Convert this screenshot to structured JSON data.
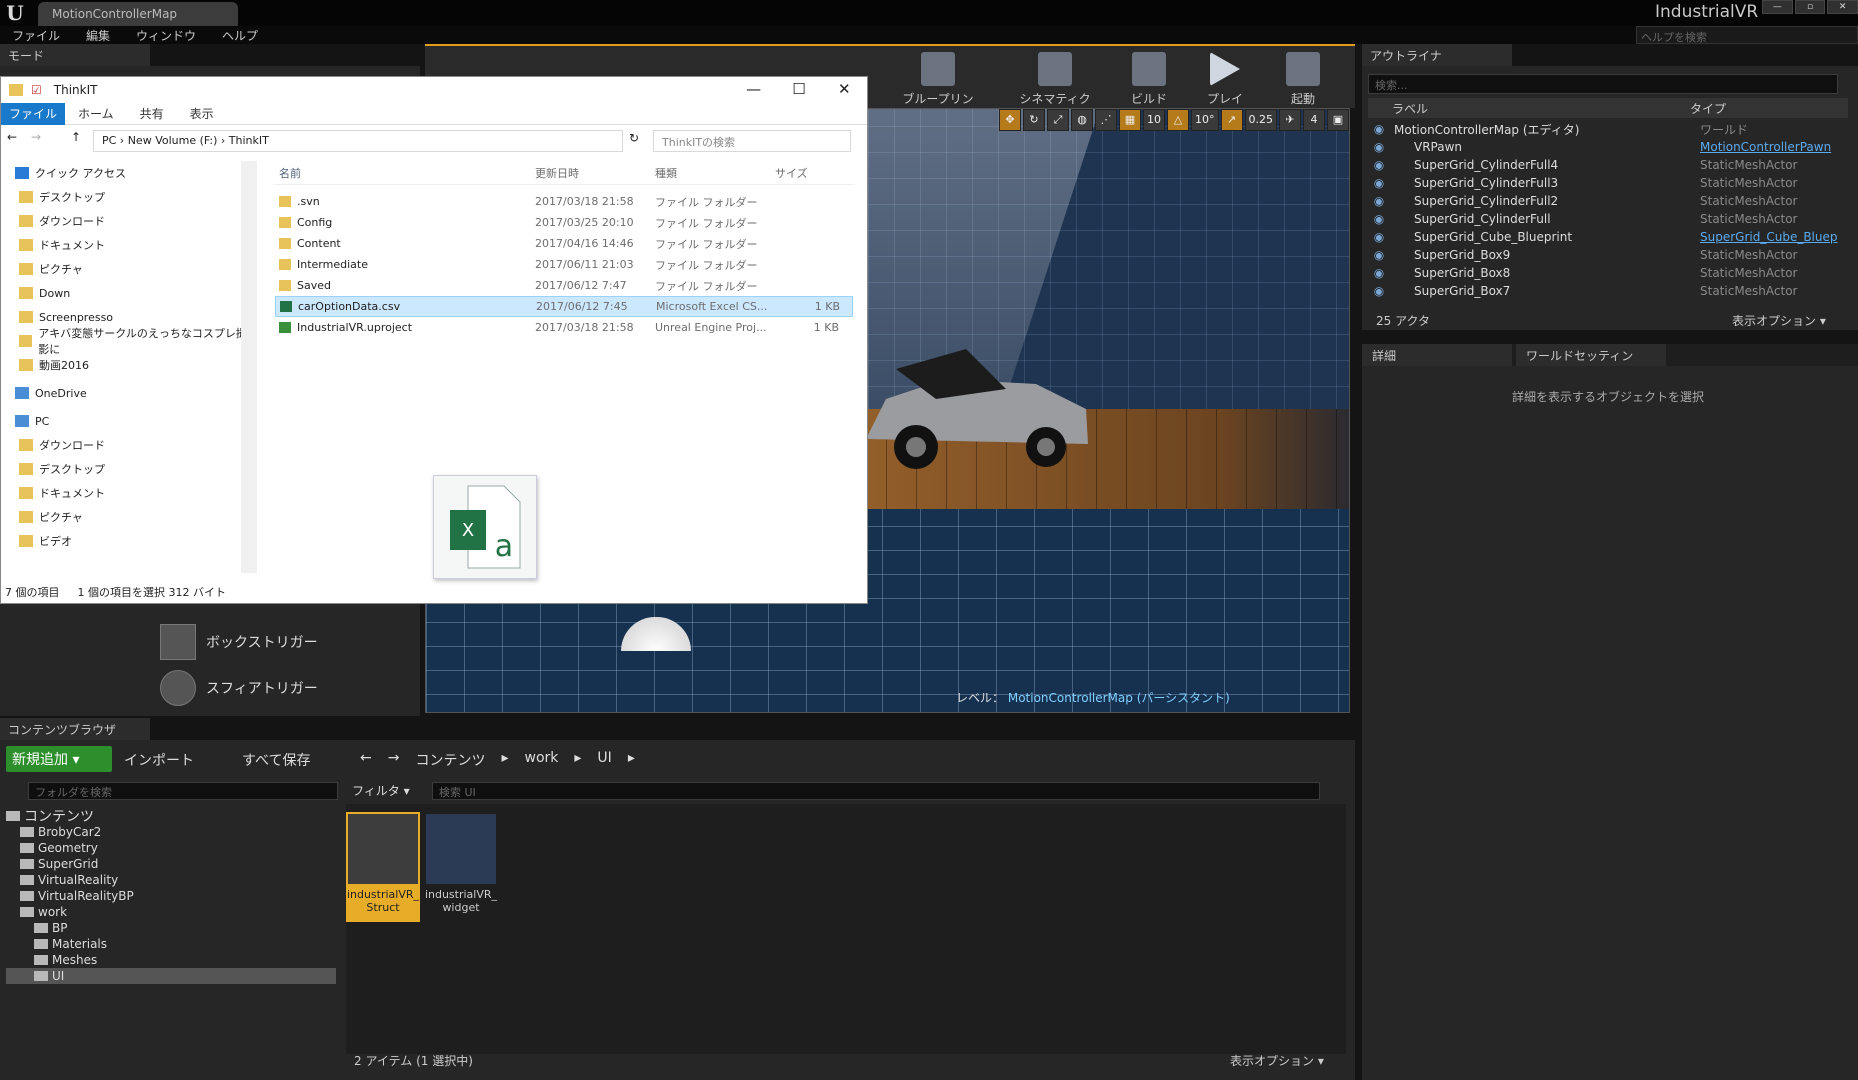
{
  "titlebar": {
    "tab": "MotionControllerMap",
    "project": "IndustrialVR",
    "help_placeholder": "ヘルプを検索"
  },
  "menu": [
    "ファイル",
    "編集",
    "ウィンドウ",
    "ヘルプ"
  ],
  "mode_tab": "モード",
  "mode_items": [
    "ボックストリガー",
    "スフィアトリガー"
  ],
  "toolbar": [
    "ブループリント",
    "シネマティクス",
    "ビルド",
    "プレイ",
    "起動"
  ],
  "viewport": {
    "toolbar": [
      "10",
      "10°",
      "0.25",
      "4"
    ],
    "level_label": "レベル：",
    "level_name": "MotionControllerMap (パーシスタント)"
  },
  "explorer": {
    "title": "ThinkIT",
    "ribbon": [
      "ファイル",
      "ホーム",
      "共有",
      "表示"
    ],
    "path": "PC  ›  New Volume (F:)  ›  ThinkIT",
    "search_placeholder": "ThinkITの検索",
    "nav": [
      {
        "label": "クイック アクセス",
        "sub": false
      },
      {
        "label": "デスクトップ",
        "sub": true
      },
      {
        "label": "ダウンロード",
        "sub": true
      },
      {
        "label": "ドキュメント",
        "sub": true
      },
      {
        "label": "ピクチャ",
        "sub": true
      },
      {
        "label": "Down",
        "sub": true
      },
      {
        "label": "Screenpresso",
        "sub": true
      },
      {
        "label": "アキバ変態サークルのえっちなコスプレ撮影に",
        "sub": true
      },
      {
        "label": "動画2016",
        "sub": true
      },
      {
        "label": "OneDrive",
        "sub": false
      },
      {
        "label": "PC",
        "sub": false
      },
      {
        "label": "ダウンロード",
        "sub": true
      },
      {
        "label": "デスクトップ",
        "sub": true
      },
      {
        "label": "ドキュメント",
        "sub": true
      },
      {
        "label": "ピクチャ",
        "sub": true
      },
      {
        "label": "ビデオ",
        "sub": true
      }
    ],
    "columns": [
      "名前",
      "更新日時",
      "種類",
      "サイズ"
    ],
    "files": [
      {
        "name": ".svn",
        "date": "2017/03/18 21:58",
        "type": "ファイル フォルダー",
        "size": "",
        "selected": false
      },
      {
        "name": "Config",
        "date": "2017/03/25 20:10",
        "type": "ファイル フォルダー",
        "size": "",
        "selected": false
      },
      {
        "name": "Content",
        "date": "2017/04/16 14:46",
        "type": "ファイル フォルダー",
        "size": "",
        "selected": false
      },
      {
        "name": "Intermediate",
        "date": "2017/06/11 21:03",
        "type": "ファイル フォルダー",
        "size": "",
        "selected": false
      },
      {
        "name": "Saved",
        "date": "2017/06/12 7:47",
        "type": "ファイル フォルダー",
        "size": "",
        "selected": false
      },
      {
        "name": "carOptionData.csv",
        "date": "2017/06/12 7:45",
        "type": "Microsoft Excel CS...",
        "size": "1 KB",
        "selected": true
      },
      {
        "name": "IndustrialVR.uproject",
        "date": "2017/03/18 21:58",
        "type": "Unreal Engine Proj...",
        "size": "1 KB",
        "selected": false
      }
    ],
    "status": [
      "7 個の項目",
      "1 個の項目を選択  312 バイト"
    ]
  },
  "outliner": {
    "tab": "アウトライナ",
    "search_placeholder": "検索...",
    "columns": [
      "ラベル",
      "タイプ"
    ],
    "rows": [
      {
        "label": "MotionControllerMap (エディタ)",
        "type": "ワールド",
        "link": false
      },
      {
        "label": "VRPawn",
        "type": "MotionControllerPawn",
        "link": true
      },
      {
        "label": "SuperGrid_CylinderFull4",
        "type": "StaticMeshActor",
        "link": false
      },
      {
        "label": "SuperGrid_CylinderFull3",
        "type": "StaticMeshActor",
        "link": false
      },
      {
        "label": "SuperGrid_CylinderFull2",
        "type": "StaticMeshActor",
        "link": false
      },
      {
        "label": "SuperGrid_CylinderFull",
        "type": "StaticMeshActor",
        "link": false
      },
      {
        "label": "SuperGrid_Cube_Blueprint",
        "type": "SuperGrid_Cube_Bluep",
        "link": true
      },
      {
        "label": "SuperGrid_Box9",
        "type": "StaticMeshActor",
        "link": false
      },
      {
        "label": "SuperGrid_Box8",
        "type": "StaticMeshActor",
        "link": false
      },
      {
        "label": "SuperGrid_Box7",
        "type": "StaticMeshActor",
        "link": false
      }
    ],
    "count": "25 アクタ",
    "view_options": "表示オプション ▾"
  },
  "details": {
    "tabs": [
      "詳細",
      "ワールドセッティン"
    ],
    "message": "詳細を表示するオブジェクトを選択"
  },
  "content_browser": {
    "tab": "コンテンツブラウザ",
    "add": "新規追加 ▾",
    "import": "インポート",
    "save_all": "すべて保存",
    "path": [
      "コンテンツ",
      "work",
      "UI"
    ],
    "folder_search": "フォルダを検索",
    "filter": "フィルタ ▾",
    "search_placeholder": "検索 UI",
    "tree": [
      {
        "label": "コンテンツ",
        "depth": 0
      },
      {
        "label": "BrobyCar2",
        "depth": 1
      },
      {
        "label": "Geometry",
        "depth": 1
      },
      {
        "label": "SuperGrid",
        "depth": 1
      },
      {
        "label": "VirtualReality",
        "depth": 1
      },
      {
        "label": "VirtualRealityBP",
        "depth": 1
      },
      {
        "label": "work",
        "depth": 1
      },
      {
        "label": "BP",
        "depth": 2
      },
      {
        "label": "Materials",
        "depth": 2
      },
      {
        "label": "Meshes",
        "depth": 2
      },
      {
        "label": "UI",
        "depth": 2
      }
    ],
    "assets": [
      {
        "name": "industrialVR_ Struct",
        "selected": true
      },
      {
        "name": "industrialVR_ widget",
        "selected": false
      }
    ],
    "count": "2 アイテム (1 選択中)",
    "view_options": "表示オプション ▾"
  }
}
